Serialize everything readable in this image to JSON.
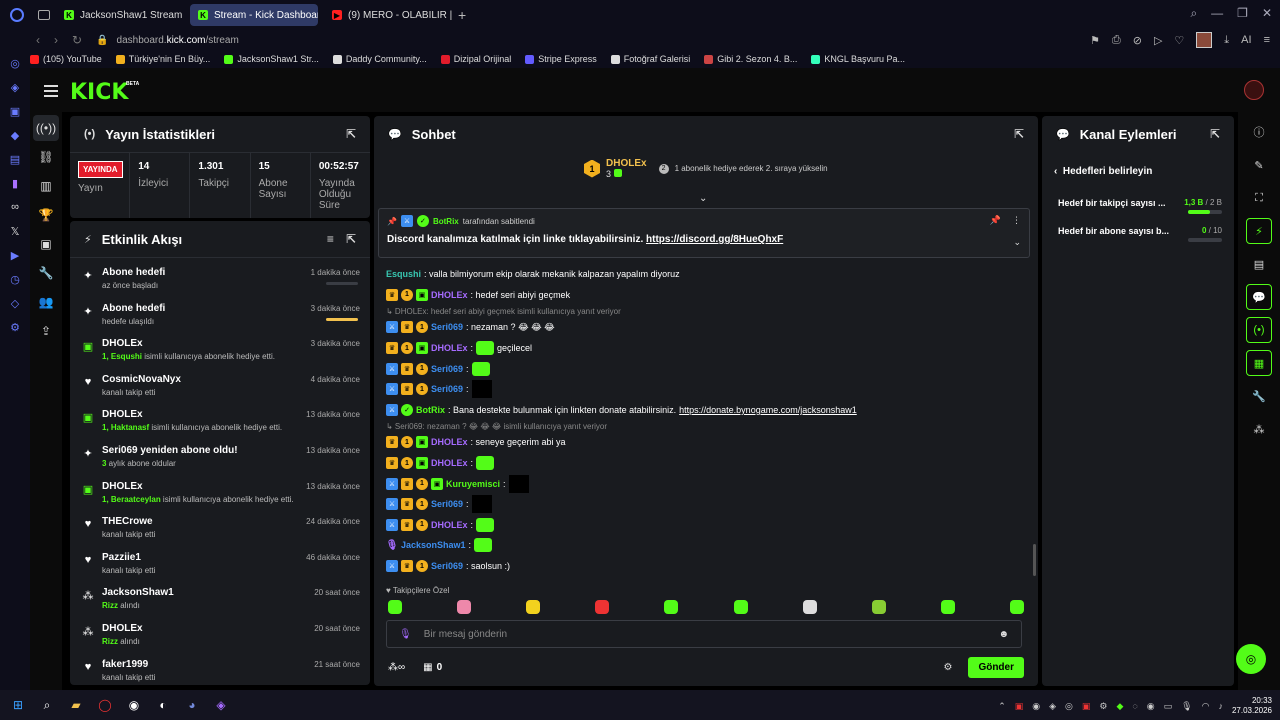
{
  "browser": {
    "tabs": [
      {
        "label": "JacksonShaw1 Stream - W",
        "fav_color": "#53fc18",
        "fav_letter": "K",
        "active": false
      },
      {
        "label": "Stream - Kick Dashboard",
        "fav_color": "#53fc18",
        "fav_letter": "K",
        "active": true
      },
      {
        "label": "(9) MERO - OLABILIR |",
        "fav_color": "#ff2020",
        "fav_letter": "▶",
        "active": false
      }
    ],
    "url_prefix": "dashboard.",
    "url_domain": "kick.com",
    "url_path": "/stream",
    "ai_label": "AI",
    "bookmarks": [
      {
        "label": "(105) YouTube",
        "color": "#ff2020"
      },
      {
        "label": "Türkiye'nin En Büy...",
        "color": "#f2b01e"
      },
      {
        "label": "JacksonShaw1 Str...",
        "color": "#53fc18"
      },
      {
        "label": "Daddy Community...",
        "color": "#dddddd"
      },
      {
        "label": "Dizipal Orijinal",
        "color": "#e21c2b"
      },
      {
        "label": "Stripe Express",
        "color": "#635bff"
      },
      {
        "label": "Fotoğraf Galerisi",
        "color": "#dddddd"
      },
      {
        "label": "Gibi 2. Sezon 4. B...",
        "color": "#c44"
      },
      {
        "label": "KNGL Başvuru Pa...",
        "color": "#3fb"
      }
    ]
  },
  "kick": {
    "logo": "KICK",
    "beta": "BETA"
  },
  "stats": {
    "title": "Yayın İstatistikleri",
    "live_badge": "YAYINDA",
    "live_label": "Yayın",
    "items": [
      {
        "value": "14",
        "label": "İzleyici"
      },
      {
        "value": "1.301",
        "label": "Takipçi"
      },
      {
        "value": "15",
        "label": "Abone Sayısı"
      },
      {
        "value": "00:52:57",
        "label": "Yayında Olduğu Süre"
      }
    ]
  },
  "feed": {
    "title": "Etkinlik Akışı",
    "items": [
      {
        "icon": "sparkle",
        "name": "Abone hedefi",
        "sub_b": "",
        "sub": "az önce başladı",
        "time": "1 dakika önce",
        "bar": "empty"
      },
      {
        "icon": "sparkle",
        "name": "Abone hedefi",
        "sub_b": "",
        "sub": "hedefe ulaşıldı",
        "time": "3 dakika önce",
        "bar": "full"
      },
      {
        "icon": "gift",
        "name": "DHOLEx",
        "sub_b": "1, Esqushi",
        "sub": " isimli kullanıcıya abonelik hediye etti.",
        "time": "3 dakika önce",
        "bar": ""
      },
      {
        "icon": "heart",
        "name": "CosmicNovaNyx",
        "sub_b": "",
        "sub": "kanalı takip etti",
        "time": "4 dakika önce",
        "bar": ""
      },
      {
        "icon": "gift",
        "name": "DHOLEx",
        "sub_b": "1, Haktanasf",
        "sub": " isimli kullanıcıya abonelik hediye etti.",
        "time": "13 dakika önce",
        "bar": ""
      },
      {
        "icon": "sparkle",
        "name": "Seri069 yeniden abone oldu!",
        "sub_b": "3",
        "sub": " aylık abone oldular",
        "time": "13 dakika önce",
        "bar": ""
      },
      {
        "icon": "gift",
        "name": "DHOLEx",
        "sub_b": "1, Beraatceylan",
        "sub": " isimli kullanıcıya abonelik hediye etti.",
        "time": "13 dakika önce",
        "bar": ""
      },
      {
        "icon": "heart",
        "name": "THECrowe",
        "sub_b": "",
        "sub": "kanalı takip etti",
        "time": "24 dakika önce",
        "bar": ""
      },
      {
        "icon": "heart",
        "name": "Pazziie1",
        "sub_b": "",
        "sub": "kanalı takip etti",
        "time": "46 dakika önce",
        "bar": ""
      },
      {
        "icon": "dots",
        "name": "JacksonShaw1",
        "sub_b": "Rizz",
        "sub": " alındı",
        "time": "20 saat önce",
        "bar": ""
      },
      {
        "icon": "dots",
        "name": "DHOLEx",
        "sub_b": "Rizz",
        "sub": " alındı",
        "time": "20 saat önce",
        "bar": ""
      },
      {
        "icon": "heart",
        "name": "faker1999",
        "sub_b": "",
        "sub": "kanalı takip etti",
        "time": "21 saat önce",
        "bar": ""
      }
    ]
  },
  "chat": {
    "title": "Sohbet",
    "goal": {
      "user": "DHOLEx",
      "rank": "1",
      "count": "3",
      "text": "1 abonelik hediye ederek 2. sıraya yükselin",
      "rank_next": "2"
    },
    "pinned": {
      "by_user": "BotRix",
      "by_text": "tarafından sabitlendi",
      "message": "Discord kanalımıza katılmak için linke tıklayabilirsiniz. ",
      "link": "https://discord.gg/8HueQhxF"
    },
    "messages": [
      {
        "type": "msg",
        "badges": [],
        "user": "Esqushi",
        "color": "u-teal",
        "text": ": valla bilmiyorum ekip olarak mekanik kalpazan yapalım diyoruz",
        "extra": ""
      },
      {
        "type": "msg",
        "badges": [
          "crown",
          "sub",
          "gift"
        ],
        "user": "DHOLEx",
        "color": "u-purple",
        "text": ": hedef seri abiyi geçmek",
        "extra": ""
      },
      {
        "type": "reply",
        "text": "↳ DHOLEx: hedef seri abiyi geçmek isimli kullanıcıya yanıt veriyor"
      },
      {
        "type": "msg",
        "badges": [
          "mod",
          "crown",
          "sub"
        ],
        "user": "Seri069",
        "color": "u-blue",
        "text": ": nezaman ? 😂 😂 😂",
        "extra": ""
      },
      {
        "type": "msg",
        "badges": [
          "crown",
          "sub",
          "gift"
        ],
        "user": "DHOLEx",
        "color": "u-purple",
        "text": ": ",
        "extra": "emote",
        "after": " geçilecel"
      },
      {
        "type": "msg",
        "badges": [
          "mod",
          "crown",
          "sub"
        ],
        "user": "Seri069",
        "color": "u-blue",
        "text": ": ",
        "extra": "emote",
        "after": ""
      },
      {
        "type": "msg",
        "badges": [
          "mod",
          "crown",
          "sub"
        ],
        "user": "Seri069",
        "color": "u-blue",
        "text": ": ",
        "extra": "block",
        "after": ""
      },
      {
        "type": "msg",
        "badges": [
          "mod",
          "verif"
        ],
        "user": "BotRix",
        "color": "u-green",
        "text": ": Bana destekte bulunmak için linkten donate atabilirsiniz. ",
        "extra": "link",
        "link": "https://donate.bynogame.com/jacksonshaw1"
      },
      {
        "type": "reply",
        "text": "↳ Seri069: nezaman ? 😂 😂 😂 isimli kullanıcıya yanıt veriyor"
      },
      {
        "type": "msg",
        "badges": [
          "crown",
          "sub",
          "gift"
        ],
        "user": "DHOLEx",
        "color": "u-purple",
        "text": ": seneye geçerim abi ya",
        "extra": ""
      },
      {
        "type": "msg",
        "badges": [
          "crown",
          "sub",
          "gift"
        ],
        "user": "DHOLEx",
        "color": "u-purple",
        "text": ": ",
        "extra": "emote",
        "after": ""
      },
      {
        "type": "msg",
        "badges": [
          "mod",
          "crown",
          "sub",
          "gift"
        ],
        "user": "Kuruyemisci",
        "color": "u-green",
        "text": ": ",
        "extra": "block",
        "after": ""
      },
      {
        "type": "msg",
        "badges": [
          "mod",
          "crown",
          "sub"
        ],
        "user": "Seri069",
        "color": "u-blue",
        "text": ": ",
        "extra": "block",
        "after": ""
      },
      {
        "type": "msg",
        "badges": [
          "mod",
          "crown",
          "sub"
        ],
        "user": "DHOLEx",
        "color": "u-purple",
        "text": ": ",
        "extra": "emote",
        "after": ""
      },
      {
        "type": "msg",
        "badges": [
          "mic"
        ],
        "user": "JacksonShaw1",
        "color": "u-blue",
        "text": ": ",
        "extra": "emote",
        "after": ""
      },
      {
        "type": "msg",
        "badges": [
          "mod",
          "crown",
          "sub"
        ],
        "user": "Seri069",
        "color": "u-blue",
        "text": ": saolsun :)",
        "extra": ""
      }
    ],
    "followers_label": "Takipçilere Özel",
    "emote_colors": [
      "#53fc18",
      "#e8a",
      "#f2d21e",
      "#e33",
      "#53fc18",
      "#53fc18",
      "#ddd",
      "#8c3",
      "#53fc18",
      "#53fc18"
    ],
    "input_placeholder": "Bir mesaj gönderin",
    "points": "0",
    "send": "Gönder"
  },
  "actions": {
    "title": "Kanal Eylemleri",
    "back_label": "Hedefleri belirleyin",
    "goals": [
      {
        "label": "Hedef bir takipçi sayısı ...",
        "current": "1,3 B",
        "target": " / 2 B",
        "fill": 0.65
      },
      {
        "label": "Hedef bir abone sayısı b...",
        "current": "0",
        "target": " / 10",
        "fill": 0
      }
    ]
  },
  "taskbar": {
    "time": "20:33",
    "date": "27.03.2026"
  }
}
